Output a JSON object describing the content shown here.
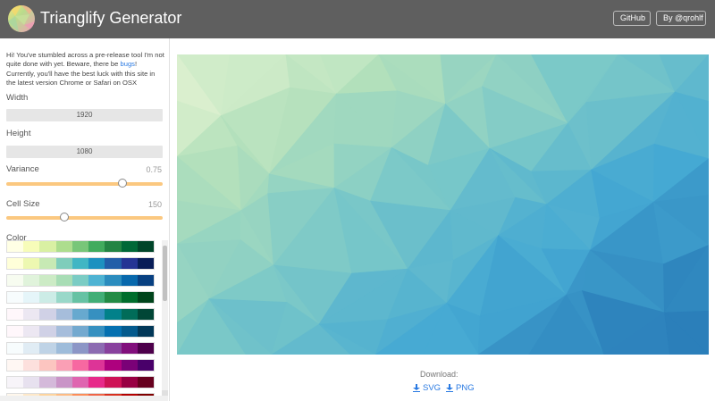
{
  "header": {
    "title": "Trianglify Generator",
    "github_label": "GitHub",
    "author_label": "By @qrohlf"
  },
  "sidebar": {
    "intro_text": "Hi! You've stumbled across a pre-release tool I'm not quite done with yet. Beware, there be ",
    "intro_link": "bugs",
    "intro_text_end": "! Currently, you'll have the best luck with this site in the latest version Chrome or Safari on OSX",
    "width_label": "Width",
    "width_value": "1920",
    "height_label": "Height",
    "height_value": "1080",
    "variance_label": "Variance",
    "variance_value": "0.75",
    "cell_size_label": "Cell Size",
    "cell_size_value": "150",
    "color_label": "Color",
    "variance_fraction": 0.74,
    "cell_size_fraction": 0.37,
    "palettes": [
      [
        "#ffffe5",
        "#f7fcb9",
        "#d9f0a3",
        "#addd8e",
        "#78c679",
        "#41ab5d",
        "#238443",
        "#006837",
        "#004529"
      ],
      [
        "#ffffd9",
        "#edf8b1",
        "#c7e9b4",
        "#7fcdbb",
        "#41b6c4",
        "#1d91c0",
        "#225ea8",
        "#253494",
        "#081d58"
      ],
      [
        "#f7fcf0",
        "#e0f3db",
        "#ccebc5",
        "#a8ddb5",
        "#7bccc4",
        "#4eb3d3",
        "#2b8cbe",
        "#0868ac",
        "#084081"
      ],
      [
        "#f7fcfd",
        "#e5f5f9",
        "#ccece6",
        "#99d8c9",
        "#66c2a4",
        "#41ae76",
        "#238b45",
        "#006d2c",
        "#00441b"
      ],
      [
        "#fff7fb",
        "#ece7f2",
        "#d0d1e6",
        "#a6bddb",
        "#67a9cf",
        "#3690c0",
        "#02818a",
        "#016c59",
        "#014636"
      ],
      [
        "#fff7fb",
        "#ece7f2",
        "#d0d1e6",
        "#a6bddb",
        "#74a9cf",
        "#3690c0",
        "#0570b0",
        "#045a8d",
        "#023858"
      ],
      [
        "#f7fcfd",
        "#e0ecf4",
        "#bfd3e6",
        "#9ebcda",
        "#8c96c6",
        "#8c6bb1",
        "#88419d",
        "#810f7c",
        "#4d004b"
      ],
      [
        "#fff7f3",
        "#fde0dd",
        "#fcc5c0",
        "#fa9fb5",
        "#f768a1",
        "#dd3497",
        "#ae017e",
        "#7a0177",
        "#49006a"
      ],
      [
        "#f7f4f9",
        "#e7e1ef",
        "#d4b9da",
        "#c994c7",
        "#df65b0",
        "#e7298a",
        "#ce1256",
        "#980043",
        "#67001f"
      ],
      [
        "#fff7ec",
        "#fee8c8",
        "#fdd49e",
        "#fdbb84",
        "#fc8d59",
        "#ef6548",
        "#d7301f",
        "#b30000",
        "#7f0000"
      ]
    ]
  },
  "preview": {
    "gradient_stops": [
      "#e3f3d2",
      "#b2e0bb",
      "#7ac8c8",
      "#45a9d3",
      "#2b7fba"
    ]
  },
  "download": {
    "label": "Download:",
    "svg_label": "SVG",
    "png_label": "PNG"
  }
}
